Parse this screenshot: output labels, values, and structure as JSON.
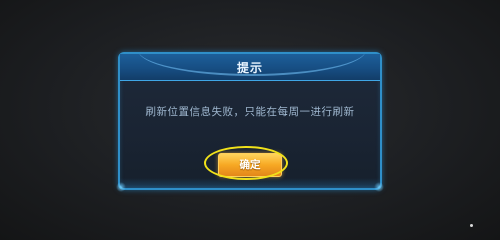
{
  "dialog": {
    "title": "提示",
    "message": "刷新位置信息失败，只能在每周一进行刷新",
    "confirm_label": "确定"
  },
  "colors": {
    "frame": "#2f8fc9",
    "header": "#1d5f9a",
    "confirm_button": "#f7a823",
    "highlight_ring": "#f1e21a"
  }
}
